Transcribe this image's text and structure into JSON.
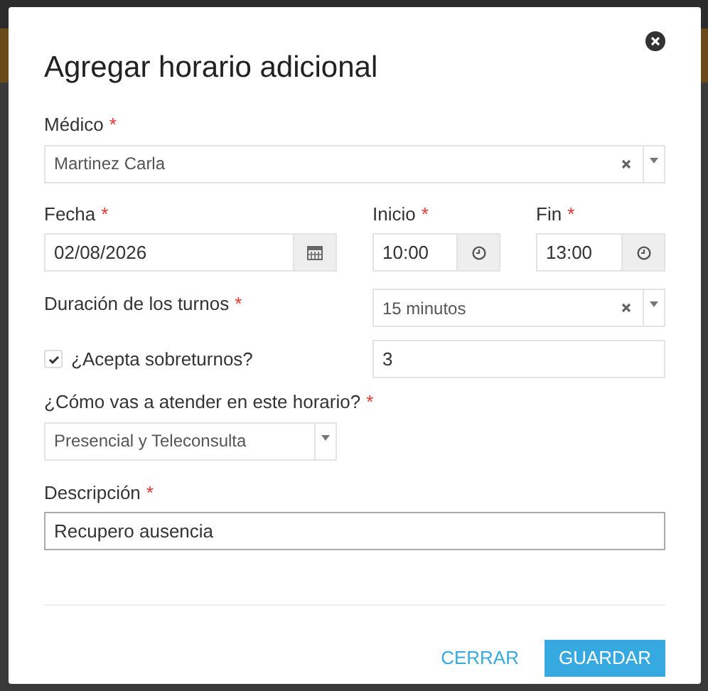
{
  "dialog": {
    "title": "Agregar horario adicional"
  },
  "medico": {
    "label": "Médico",
    "required_mark": "*",
    "value": "Martinez Carla",
    "clearable": true
  },
  "fecha": {
    "label": "Fecha",
    "required_mark": "*",
    "value": "02/08/2026"
  },
  "inicio": {
    "label": "Inicio",
    "required_mark": "*",
    "value": "10:00"
  },
  "fin": {
    "label": "Fin",
    "required_mark": "*",
    "value": "13:00"
  },
  "duracion": {
    "label": "Duración de los turnos",
    "required_mark": "*",
    "value": "15 minutos",
    "clearable": true
  },
  "sobreturnos": {
    "label": "¿Acepta sobreturnos?",
    "checked": true,
    "value": "3"
  },
  "modalidad": {
    "label": "¿Cómo vas a atender en este horario?",
    "required_mark": "*",
    "value": "Presencial y Teleconsulta",
    "clearable": false
  },
  "descripcion": {
    "label": "Descripción",
    "required_mark": "*",
    "value": "Recupero ausencia"
  },
  "buttons": [
    {
      "kind": "secondary",
      "label": "CERRAR"
    },
    {
      "kind": "primary",
      "label": "GUARDAR"
    }
  ]
}
